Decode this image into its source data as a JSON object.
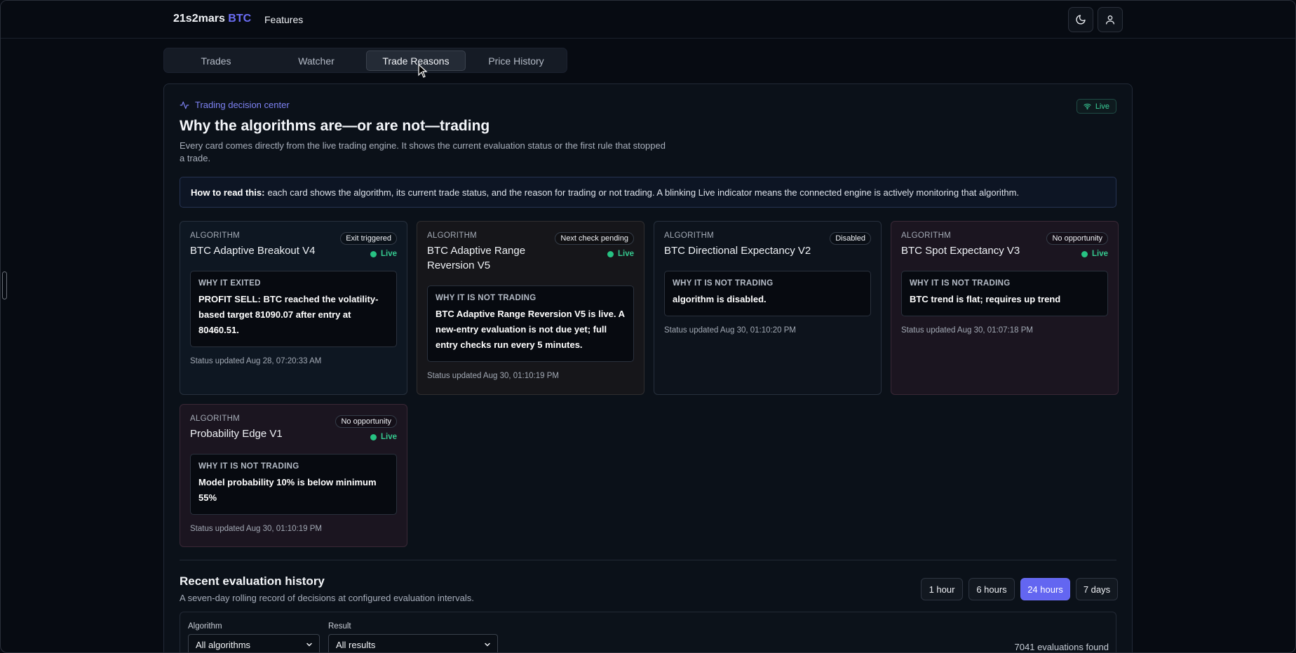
{
  "nav": {
    "brand_main": "21s2mars",
    "brand_accent": "BTC",
    "features_label": "Features",
    "theme_icon": "moon-icon",
    "user_icon": "user-icon"
  },
  "tabs": [
    {
      "label": "Trades",
      "active": false
    },
    {
      "label": "Watcher",
      "active": false
    },
    {
      "label": "Trade Reasons",
      "active": true
    },
    {
      "label": "Price History",
      "active": false
    }
  ],
  "panel": {
    "eyebrow": "Trading decision center",
    "live_label": "Live",
    "headline": "Why the algorithms are—or are not—trading",
    "subline": "Every card comes directly from the live trading engine. It shows the current evaluation status or the first rule that stopped a trade.",
    "howto_bold": "How to read this:",
    "howto_text": "each card shows the algorithm, its current trade status, and the reason for trading or not trading. A blinking Live indicator means the connected engine is actively monitoring that algorithm."
  },
  "cards": [
    {
      "label": "ALGORITHM",
      "name": "BTC Adaptive Breakout V4",
      "badge": "Exit triggered",
      "live": "Live",
      "reason_title": "WHY IT EXITED",
      "reason_text": "PROFIT SELL: BTC reached the volatility-based target 81090.07 after entry at 80460.51.",
      "status": "Status updated Aug 28, 07:20:33 AM"
    },
    {
      "label": "ALGORITHM",
      "name": "BTC Adaptive Range Reversion V5",
      "badge": "Next check pending",
      "live": "Live",
      "reason_title": "WHY IT IS NOT TRADING",
      "reason_text": "BTC Adaptive Range Reversion V5 is live. A new-entry evaluation is not due yet; full entry checks run every 5 minutes.",
      "status": "Status updated Aug 30, 01:10:19 PM"
    },
    {
      "label": "ALGORITHM",
      "name": "BTC Directional Expectancy V2",
      "badge": "Disabled",
      "reason_title": "WHY IT IS NOT TRADING",
      "reason_text": "algorithm is disabled.",
      "status": "Status updated Aug 30, 01:10:20 PM"
    },
    {
      "label": "ALGORITHM",
      "name": "BTC Spot Expectancy V3",
      "badge": "No opportunity",
      "live": "Live",
      "reason_title": "WHY IT IS NOT TRADING",
      "reason_text": "BTC trend is flat; requires up trend",
      "status": "Status updated Aug 30, 01:07:18 PM"
    },
    {
      "label": "ALGORITHM",
      "name": "Probability Edge V1",
      "badge": "No opportunity",
      "live": "Live",
      "reason_title": "WHY IT IS NOT TRADING",
      "reason_text": "Model probability 10% is below minimum 55%",
      "status": "Status updated Aug 30, 01:10:19 PM"
    }
  ],
  "history": {
    "title": "Recent evaluation history",
    "subtitle": "A seven-day rolling record of decisions at configured evaluation intervals.",
    "ranges": [
      {
        "label": "1 hour",
        "active": false
      },
      {
        "label": "6 hours",
        "active": false
      },
      {
        "label": "24 hours",
        "active": true
      },
      {
        "label": "7 days",
        "active": false
      }
    ],
    "algorithm_filter_label": "Algorithm",
    "algorithm_filter_value": "All algorithms",
    "result_filter_label": "Result",
    "result_filter_value": "All results",
    "count": "7041 evaluations found"
  },
  "colors": {
    "accent": "#6366f1",
    "live_green": "#27c283",
    "background": "#070b12"
  }
}
